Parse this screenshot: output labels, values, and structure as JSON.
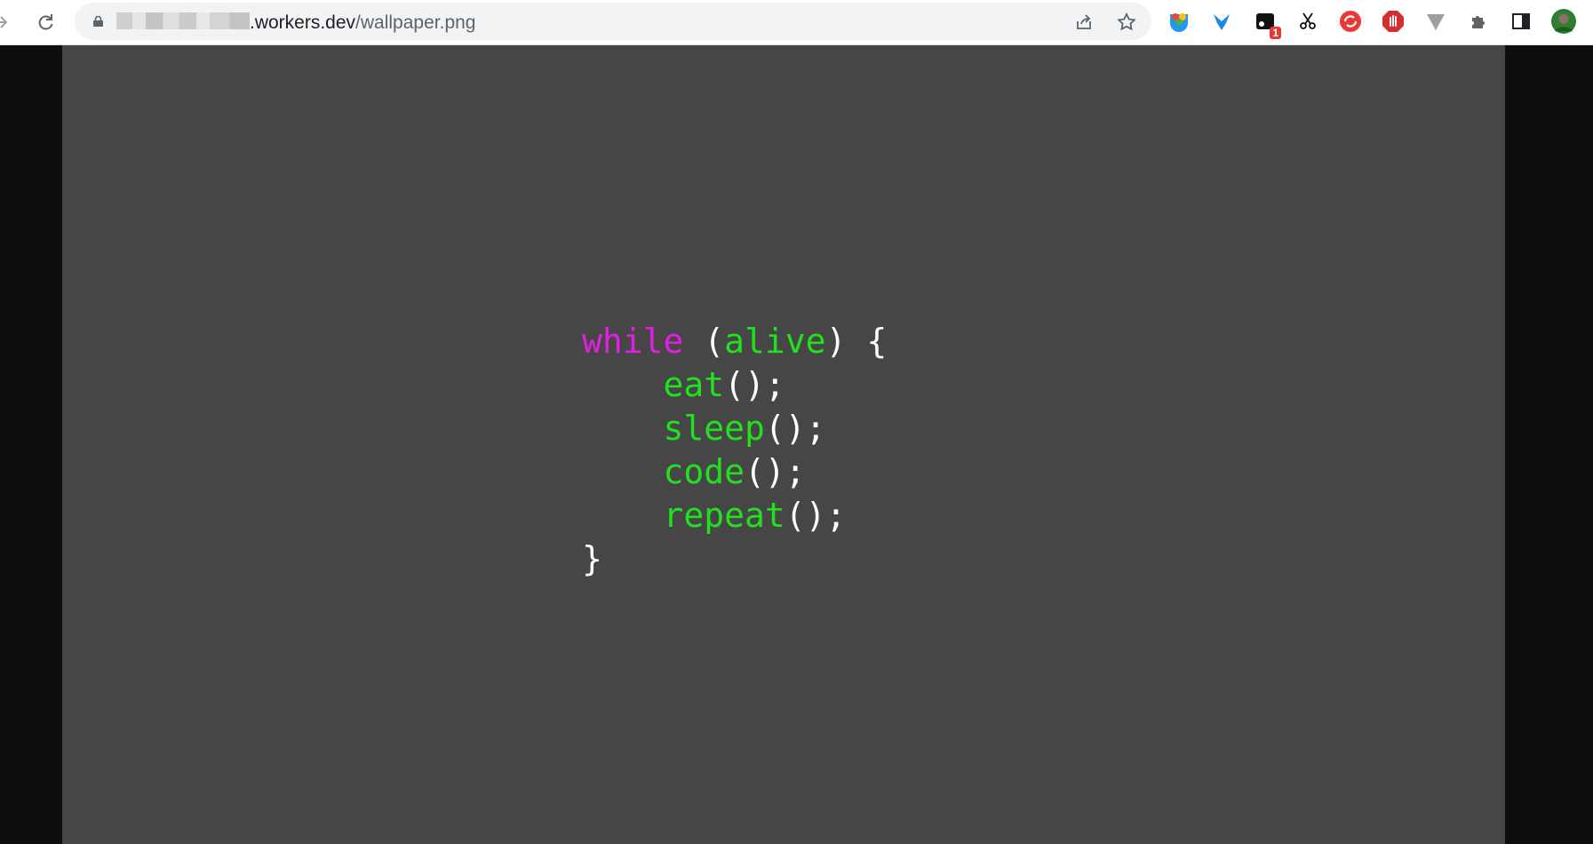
{
  "browser": {
    "url_host": ".workers.dev",
    "url_path": "/wallpaper.png",
    "extension_badge": "1",
    "icons": [
      "forward-icon",
      "reload-icon",
      "lock-icon",
      "share-icon",
      "bookmark-star-icon",
      "extensions-puzzle-icon",
      "side-panel-icon",
      "profile-avatar"
    ]
  },
  "wallpaper": {
    "background_color": "#464646",
    "code": {
      "line1": {
        "keyword": "while",
        "open_paren": "(",
        "condition": "alive",
        "close": ") {"
      },
      "line2": {
        "call": "eat",
        "tail": "();"
      },
      "line3": {
        "call": "sleep",
        "tail": "();"
      },
      "line4": {
        "call": "code",
        "tail": "();"
      },
      "line5": {
        "call": "repeat",
        "tail": "();"
      },
      "line6": {
        "close_brace": "}"
      }
    },
    "colors": {
      "keyword": "#e020e0",
      "function": "#20e020",
      "punctuation": "#ffffff"
    }
  }
}
